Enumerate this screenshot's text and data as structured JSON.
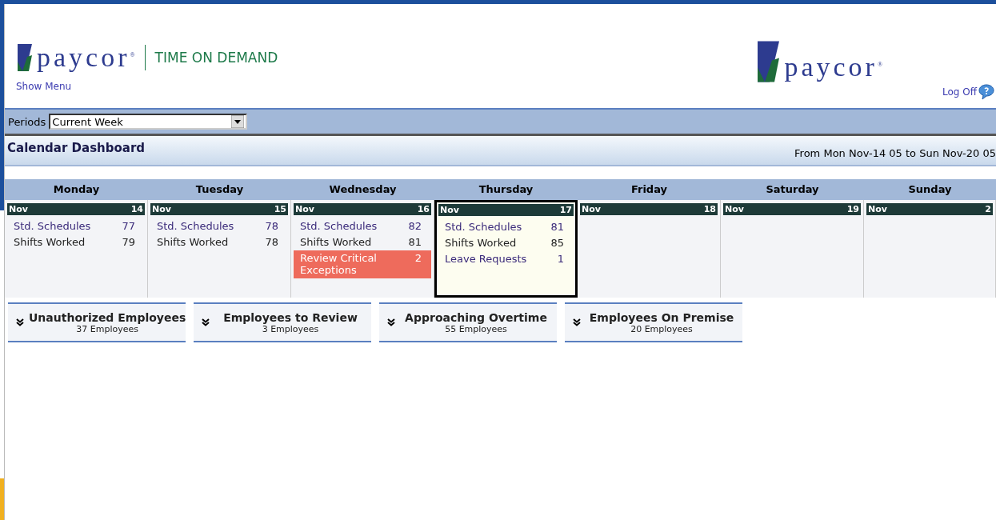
{
  "header": {
    "logo_text": "paycor$^{®}$",
    "product": "TIME ON DEMAND",
    "show_menu": "Show Menu",
    "right_logo_text": "paycor$^{®}$",
    "log_off": "Log Off"
  },
  "periods": {
    "label": "Periods",
    "value": "Current Week"
  },
  "dashboard": {
    "title": "Calendar Dashboard",
    "range": "From Mon Nov-14 05 to Sun Nov-20 05"
  },
  "days": [
    {
      "name": "Monday",
      "month": "Nov",
      "date": "14",
      "selected": false,
      "entries": [
        {
          "kind": "link",
          "label": "Std. Schedules",
          "count": "77"
        },
        {
          "kind": "plain",
          "label": "Shifts Worked",
          "count": "79"
        }
      ]
    },
    {
      "name": "Tuesday",
      "month": "Nov",
      "date": "15",
      "selected": false,
      "entries": [
        {
          "kind": "link",
          "label": "Std. Schedules",
          "count": "78"
        },
        {
          "kind": "plain",
          "label": "Shifts Worked",
          "count": "78"
        }
      ]
    },
    {
      "name": "Wednesday",
      "month": "Nov",
      "date": "16",
      "selected": false,
      "entries": [
        {
          "kind": "link",
          "label": "Std. Schedules",
          "count": "82"
        },
        {
          "kind": "plain",
          "label": "Shifts Worked",
          "count": "81"
        },
        {
          "kind": "alert",
          "label": "Review Critical Exceptions",
          "count": "2"
        }
      ]
    },
    {
      "name": "Thursday",
      "month": "Nov",
      "date": "17",
      "selected": true,
      "entries": [
        {
          "kind": "link",
          "label": "Std. Schedules",
          "count": "81"
        },
        {
          "kind": "plain",
          "label": "Shifts Worked",
          "count": "85"
        },
        {
          "kind": "link",
          "label": "Leave Requests",
          "count": "1"
        }
      ]
    },
    {
      "name": "Friday",
      "month": "Nov",
      "date": "18",
      "selected": false
    },
    {
      "name": "Saturday",
      "month": "Nov",
      "date": "19",
      "selected": false
    },
    {
      "name": "Sunday",
      "month": "Nov",
      "date": "2",
      "selected": false
    }
  ],
  "panels": [
    {
      "title": "Unauthorized Employees",
      "count": "37 Employees"
    },
    {
      "title": "Employees to Review",
      "count": "3 Employees"
    },
    {
      "title": "Approaching Overtime",
      "count": "55 Employees"
    },
    {
      "title": "Employees On Premise",
      "count": "20 Employees"
    }
  ]
}
